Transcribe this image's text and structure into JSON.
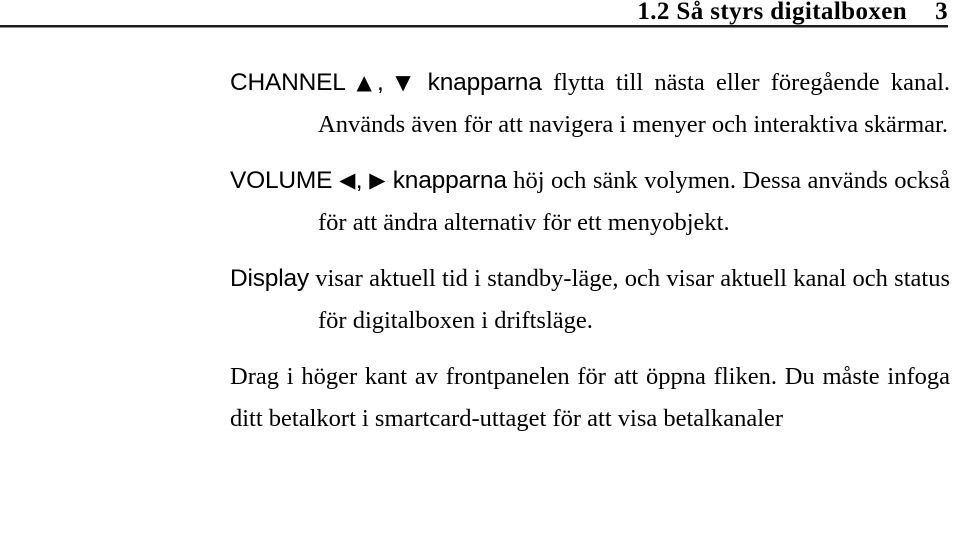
{
  "header": {
    "section_number": "1.2",
    "section_title": "Så styrs digitalboxen",
    "title_full": "1.2 Så styrs digitalboxen",
    "page_number": "3"
  },
  "paragraphs": {
    "channel": {
      "term": "CHANNEL",
      "glyph_up": "▲",
      "glyph_separator": ",",
      "glyph_down": "▼",
      "term_suffix": "knapparna",
      "body": "flytta till nästa eller föregående kanal. Används även för att navigera i menyer och interaktiva skärmar."
    },
    "volume": {
      "term": "VOLUME",
      "glyph_left": "◀",
      "glyph_separator": ",",
      "glyph_right": "▶",
      "term_suffix": "knapparna",
      "body": "höj och sänk volymen. Dessa används också för att ändra alternativ för ett menyobjekt."
    },
    "display": {
      "term": "Display",
      "body": "visar aktuell tid i standby-läge, och visar aktuell kanal och status för digitalboxen i driftsläge."
    },
    "smartcard": {
      "body": "Drag i höger kant av frontpanelen för att öppna fliken. Du måste infoga ditt betalkort i smartcard-uttaget för att visa betalkanaler"
    }
  }
}
